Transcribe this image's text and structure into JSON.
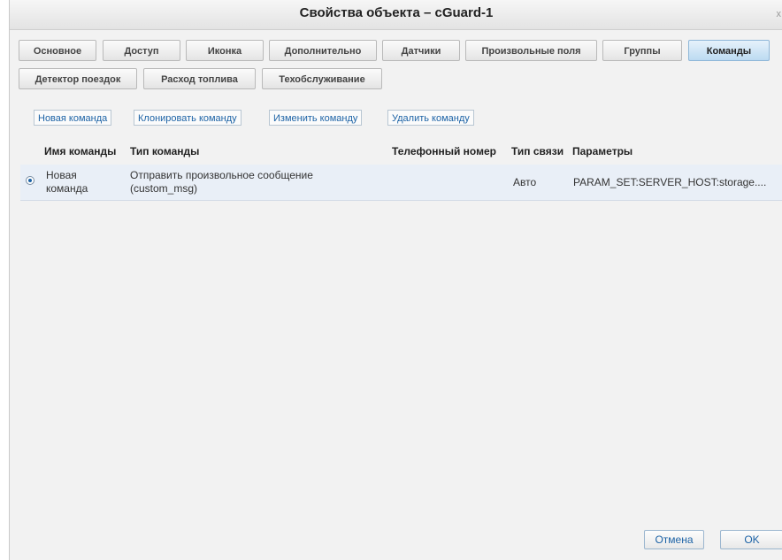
{
  "window": {
    "title": "Свойства объекта – cGuard-1",
    "close_label": "x"
  },
  "tabs": [
    {
      "label": "Основное"
    },
    {
      "label": "Доступ"
    },
    {
      "label": "Иконка"
    },
    {
      "label": "Дополнительно"
    },
    {
      "label": "Датчики"
    },
    {
      "label": "Произвольные поля"
    },
    {
      "label": "Группы"
    },
    {
      "label": "Команды",
      "active": true
    },
    {
      "label": "Детектор поездок"
    },
    {
      "label": "Расход топлива"
    },
    {
      "label": "Техобслуживание"
    }
  ],
  "actions": {
    "new_command": "Новая команда",
    "clone_command": "Клонировать команду",
    "edit_command": "Изменить команду",
    "delete_command": "Удалить команду"
  },
  "table": {
    "headers": {
      "name": "Имя команды",
      "type": "Тип команды",
      "phone": "Телефонный номер",
      "link": "Тип связи",
      "params": "Параметры"
    },
    "rows": [
      {
        "selected": true,
        "name_line1": "Новая",
        "name_line2": "команда",
        "type_line1": "Отправить произвольное сообщение",
        "type_line2": "(custom_msg)",
        "phone": "",
        "link": "Авто",
        "params": "PARAM_SET:SERVER_HOST:storage...."
      }
    ]
  },
  "footer": {
    "cancel": "Отмена",
    "ok": "OK"
  },
  "colors": {
    "accent": "#1d63a6",
    "active_tab": "#bcdaf1",
    "row_selected": "#e9eff7"
  }
}
